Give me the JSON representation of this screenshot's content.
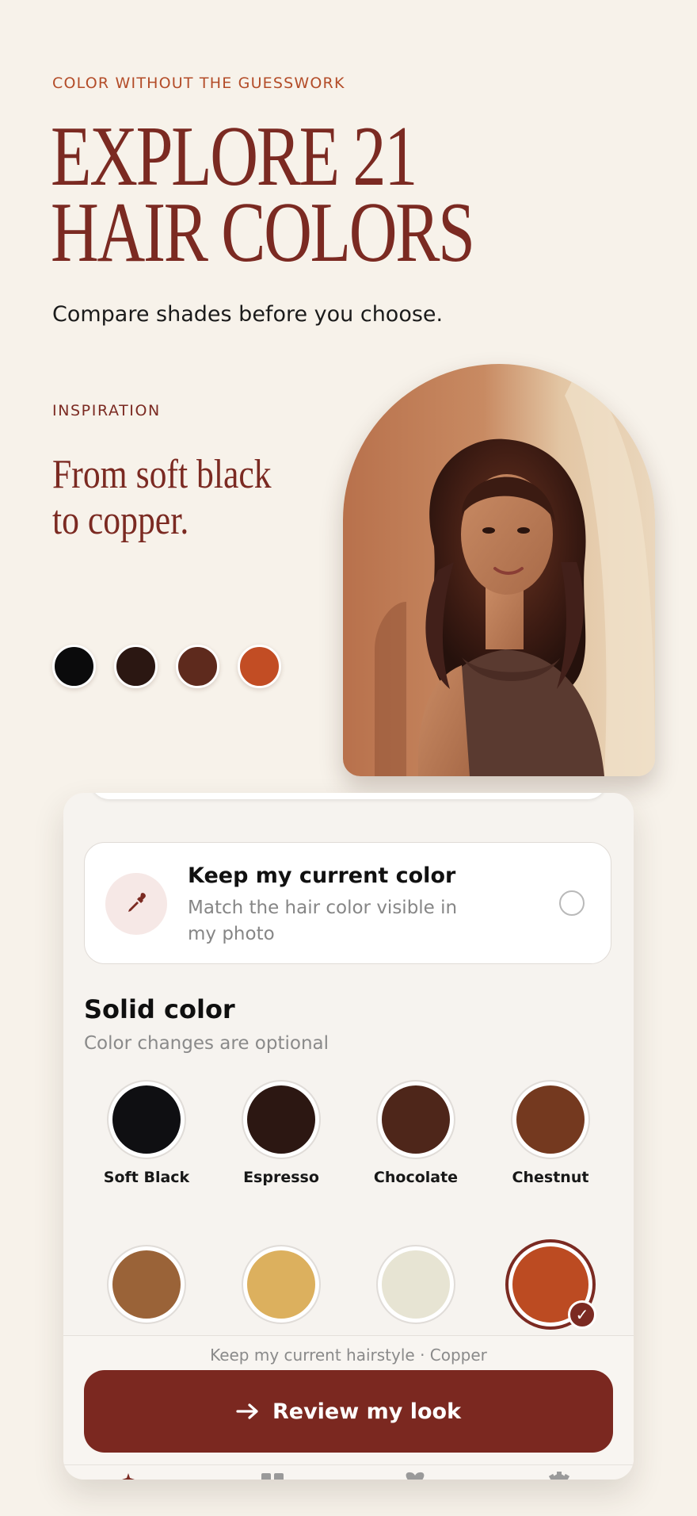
{
  "hero": {
    "eyebrow": "COLOR WITHOUT THE GUESSWORK",
    "title_line_1": "EXPLORE 21",
    "title_line_2": "HAIR COLORS",
    "subtitle": "Compare shades before you choose."
  },
  "inspiration": {
    "label": "INSPIRATION",
    "text_line_1": "From soft black",
    "text_line_2": "to copper.",
    "dots": [
      "#0b0b0c",
      "#2b1712",
      "#5e2a1d",
      "#c24d24"
    ]
  },
  "keep_current": {
    "title": "Keep my current color",
    "description": "Match the hair color visible in my photo",
    "icon": "eyedropper-icon",
    "selected": false
  },
  "solid_color": {
    "title": "Solid color",
    "subtitle": "Color changes are optional",
    "swatches": [
      {
        "name": "Soft Black",
        "color": "#0f0f12"
      },
      {
        "name": "Espresso",
        "color": "#2c1712"
      },
      {
        "name": "Chocolate",
        "color": "#4e261a"
      },
      {
        "name": "Chestnut",
        "color": "#74391f"
      },
      {
        "name": "",
        "color": "#9a6338"
      },
      {
        "name": "",
        "color": "#dcb05e"
      },
      {
        "name": "",
        "color": "#e7e4d3"
      },
      {
        "name": "",
        "color": "#bc4b22",
        "selected": true
      }
    ]
  },
  "footer": {
    "summary": "Keep my current hairstyle · Copper",
    "button_label": "Review my look",
    "button_icon": "arrow-right-icon"
  },
  "tabbar": {
    "icons": [
      "sparkle-icon",
      "grid-icon",
      "heart-icon",
      "gear-icon"
    ]
  },
  "colors": {
    "accent": "#7b2a22",
    "eyebrow": "#b34c28",
    "background": "#f7f2ea"
  }
}
